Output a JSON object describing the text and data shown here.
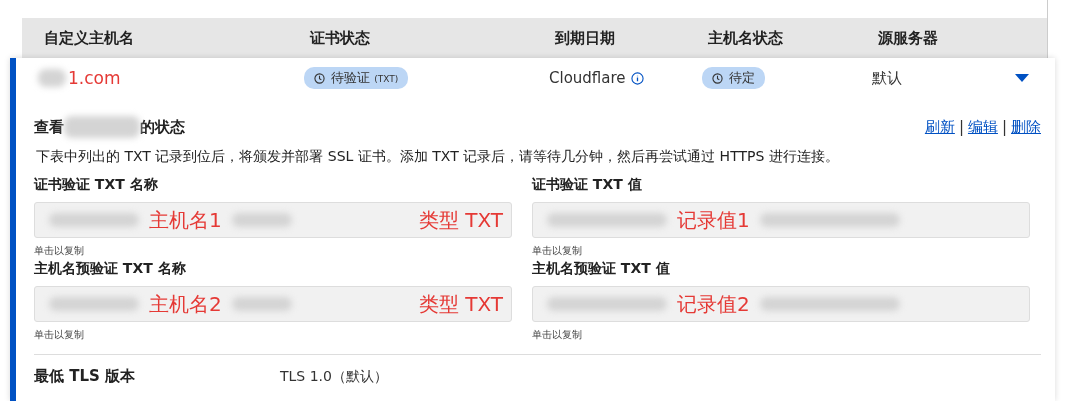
{
  "table": {
    "columns": [
      "自定义主机名",
      "证书状态",
      "到期日期",
      "主机名状态",
      "源服务器"
    ]
  },
  "row": {
    "hostname": "1.com",
    "cert_status": "待验证",
    "cert_status_note": "(TXT)",
    "expiry": "Cloudflare",
    "host_status": "待定",
    "origin": "默认",
    "expanded": true
  },
  "details": {
    "title_prefix": "查看",
    "title_suffix": "的状态",
    "actions": [
      "刷新",
      "编辑",
      "删除"
    ],
    "action_separator": "|",
    "description": "下表中列出的 TXT 记录到位后，将颁发并部署 SSL 证书。添加 TXT 记录后，请等待几分钟，然后再尝试通过 HTTPS 进行连接。",
    "fields": [
      {
        "label": "证书验证 TXT 名称",
        "value": "主机名1",
        "tag": "类型 TXT",
        "hint": "单击以复制"
      },
      {
        "label": "证书验证 TXT 值",
        "value": "记录值1",
        "hint": "单击以复制"
      },
      {
        "label": "主机名预验证 TXT 名称",
        "value": "主机名2",
        "tag": "类型 TXT",
        "hint": "单击以复制"
      },
      {
        "label": "主机名预验证 TXT 值",
        "value": "记录值2",
        "hint": "单击以复制"
      }
    ],
    "settings": [
      {
        "label": "最低 TLS 版本",
        "value": "TLS 1.0（默认）"
      }
    ]
  }
}
